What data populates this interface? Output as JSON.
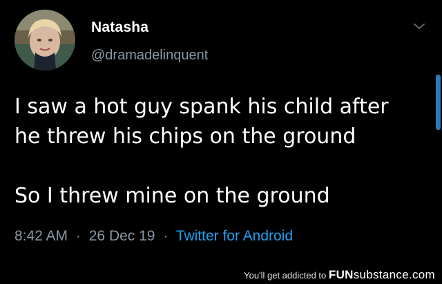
{
  "tweet": {
    "author_name": "Natasha",
    "author_handle": "@dramadelinquent",
    "lines": [
      "I saw a hot guy spank his child after",
      "he threw his chips on the ground",
      "So I threw mine on the ground"
    ],
    "time": "8:42 AM",
    "date": "26 Dec 19",
    "source": "Twitter for Android",
    "separator": "·"
  },
  "footer": {
    "tagline": "You'll get addicted to",
    "brand_bold": "FUN",
    "brand_rest": "substance",
    "brand_suffix": ".com"
  },
  "icons": {
    "caret": "chevron-down-icon"
  },
  "colors": {
    "background": "#000000",
    "text": "#ffffff",
    "muted": "#8b98a5",
    "link": "#1da1f2"
  }
}
